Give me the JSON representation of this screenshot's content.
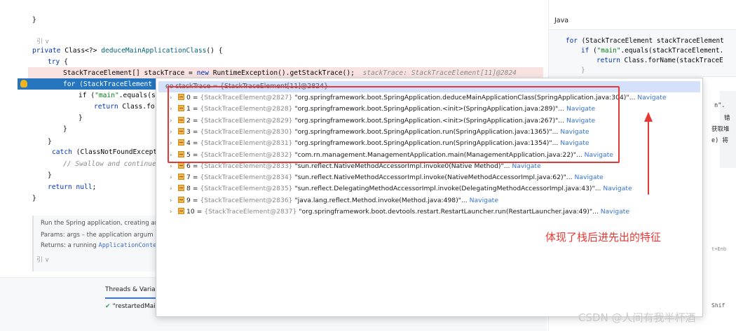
{
  "editor": {
    "lens_top": "引 ∨",
    "lens_bottom": "引 ∨",
    "lines": {
      "l_brace0": "}",
      "l1_kw": "private",
      "l1_type": " Class<?> ",
      "l1_fn": "deduceMainApplicationClass",
      "l1_rest": "() {",
      "l2_kw": "try",
      "l2_rest": " {",
      "l3_a": "StackTraceElement[] stackTrace = ",
      "l3_kw": "new",
      "l3_b": " RuntimeException().getStackTrace();",
      "l3_hint": "stackTrace: StackTraceElement[11]@2824",
      "l4_text": "for (StackTraceElement s",
      "l5_a": "if (",
      "l5_str": "\"main\"",
      "l5_b": ".equals(st",
      "l6_kw": "return",
      "l6_rest": " Class.for",
      "l7": "}",
      "l8": "}",
      "l9": "}",
      "l10_kw": "catch",
      "l10_rest": " (ClassNotFoundExcepti",
      "l11_cm": "// Swallow and continue",
      "l12": "}",
      "l13_kw": "return null",
      "l13_rest": ";",
      "l14": "}"
    },
    "doc": {
      "line1": "Run the Spring application, creating an",
      "line2_label": "Params:",
      "line2_text": "args – the application argum",
      "line3_label": "Returns:",
      "line3_text": "a running ",
      "line3_code": "ApplicationContex"
    },
    "tool_window": {
      "tab_label": "Threads & Varia",
      "thread_label": "\"restartedMai"
    }
  },
  "right_panel": {
    "title": "Java",
    "code1_kw": "for",
    "code1_rest": " (StackTraceElement stackTraceElement",
    "code2_kw": "if",
    "code2_a": " (",
    "code2_str": "\"main\"",
    "code2_b": ".equals(stackTraceElement.",
    "code3_kw": "return",
    "code3_rest": " Class.forName(stackTraceE",
    "code4": "}",
    "frag1": "n\".",
    "frag2": "错",
    "frag3": "获取堆",
    "frag4": "e) 将",
    "frag5": "t+Enb",
    "frag6": "Shif"
  },
  "popup": {
    "header": "oo stackTrace = {StackTraceElement[11]@2824}",
    "nav_label": "Navigate",
    "items": [
      {
        "index": "0",
        "ref": "{StackTraceElement@2827}",
        "value": "\"org.springframework.boot.SpringApplication.deduceMainApplicationClass(SpringApplication.java:304)\"..."
      },
      {
        "index": "1",
        "ref": "{StackTraceElement@2828}",
        "value": "\"org.springframework.boot.SpringApplication.<init>(SpringApplication.java:289)\"..."
      },
      {
        "index": "2",
        "ref": "{StackTraceElement@2829}",
        "value": "\"org.springframework.boot.SpringApplication.<init>(SpringApplication.java:267)\"..."
      },
      {
        "index": "3",
        "ref": "{StackTraceElement@2830}",
        "value": "\"org.springframework.boot.SpringApplication.run(SpringApplication.java:1365)\"..."
      },
      {
        "index": "4",
        "ref": "{StackTraceElement@2831}",
        "value": "\"org.springframework.boot.SpringApplication.run(SpringApplication.java:1354)\"..."
      },
      {
        "index": "5",
        "ref": "{StackTraceElement@2832}",
        "value": "\"com.rn.management.ManagementApplication.main(ManagementApplication.java:22)\"..."
      },
      {
        "index": "6",
        "ref": "{StackTraceElement@2833}",
        "value": "\"sun.reflect.NativeMethodAccessorImpl.invoke0(Native Method)\"..."
      },
      {
        "index": "7",
        "ref": "{StackTraceElement@2834}",
        "value": "\"sun.reflect.NativeMethodAccessorImpl.invoke(NativeMethodAccessorImpl.java:62)\"..."
      },
      {
        "index": "8",
        "ref": "{StackTraceElement@2835}",
        "value": "\"sun.reflect.DelegatingMethodAccessorImpl.invoke(DelegatingMethodAccessorImpl.java:43)\"..."
      },
      {
        "index": "9",
        "ref": "{StackTraceElement@2836}",
        "value": "\"java.lang.reflect.Method.invoke(Method.java:498)\"..."
      },
      {
        "index": "10",
        "ref": "{StackTraceElement@2837}",
        "value": "\"org.springframework.boot.devtools.restart.RestartLauncher.run(RestartLauncher.java:49)\"..."
      }
    ]
  },
  "annotation": {
    "text": "体现了栈后进先出的特征",
    "color": "#e53935"
  },
  "watermark": "CSDN @人间有我半杯酒"
}
